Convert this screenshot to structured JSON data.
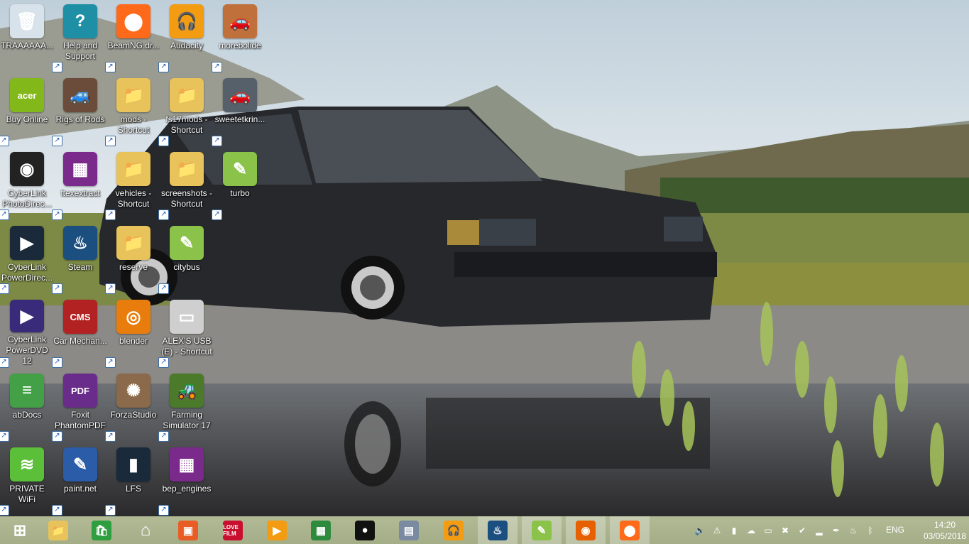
{
  "desktop": {
    "icons": [
      {
        "name": "recycle-bin",
        "label": "TRAAAAAA...",
        "glyph": "🗑",
        "color": "#d8e2ea"
      },
      {
        "name": "help-and-support",
        "label": "Help and Support",
        "glyph": "?",
        "color": "#1f8fa6"
      },
      {
        "name": "beamng",
        "label": "BeamNG.dr...",
        "glyph": "⬤",
        "color": "#ff6a1a"
      },
      {
        "name": "audacity",
        "label": "Audacity",
        "glyph": "🎧",
        "color": "#f39c12"
      },
      {
        "name": "morebolide",
        "label": "morebolide",
        "glyph": "🚗",
        "color": "#c0703a"
      },
      {
        "name": "buy-online",
        "label": "Buy Online",
        "glyph": "acer",
        "color": "#83b81a"
      },
      {
        "name": "rigs-of-rods",
        "label": "Rigs of Rods",
        "glyph": "🚙",
        "color": "#6b4c3b"
      },
      {
        "name": "mods-shortcut",
        "label": "mods - Shortcut",
        "glyph": "📁",
        "color": "#e8c25a"
      },
      {
        "name": "fs17mods-shortcut",
        "label": "fs17mods - Shortcut",
        "glyph": "📁",
        "color": "#e8c25a"
      },
      {
        "name": "sweetetkrin",
        "label": "sweetetkrin...",
        "glyph": "🚗",
        "color": "#55606a"
      },
      {
        "name": "cyberlink-photodirector",
        "label": "CyberLink PhotoDirec...",
        "glyph": "◉",
        "color": "#222"
      },
      {
        "name": "ftexextract",
        "label": "ftexextract",
        "glyph": "▦",
        "color": "#7a2a8a"
      },
      {
        "name": "vehicles-shortcut",
        "label": "vehicles - Shortcut",
        "glyph": "📁",
        "color": "#e8c25a"
      },
      {
        "name": "screenshots-shortcut",
        "label": "screenshots - Shortcut",
        "glyph": "📁",
        "color": "#e8c25a"
      },
      {
        "name": "turbo",
        "label": "turbo",
        "glyph": "✎",
        "color": "#8bc34a"
      },
      {
        "name": "cyberlink-powerdirector",
        "label": "CyberLink PowerDirec...",
        "glyph": "▶",
        "color": "#1a2a3a"
      },
      {
        "name": "steam",
        "label": "Steam",
        "glyph": "♨",
        "color": "#1b4f80"
      },
      {
        "name": "reserve",
        "label": "reserve",
        "glyph": "📁",
        "color": "#e8c25a"
      },
      {
        "name": "citybus",
        "label": "citybus",
        "glyph": "✎",
        "color": "#8bc34a"
      },
      {
        "name": "cyberlink-powerdvd",
        "label": "CyberLink PowerDVD 12",
        "glyph": "▶",
        "color": "#3a2a7a"
      },
      {
        "name": "car-mechanic",
        "label": "Car Mechan...",
        "glyph": "CMS",
        "color": "#b22222"
      },
      {
        "name": "blender",
        "label": "blender",
        "glyph": "◎",
        "color": "#e87d0d"
      },
      {
        "name": "alexs-usb-shortcut",
        "label": "ALEX'S USB (E) - Shortcut",
        "glyph": "▭",
        "color": "#cfcfcf"
      },
      {
        "name": "abdocs",
        "label": "abDocs",
        "glyph": "≡",
        "color": "#43a047"
      },
      {
        "name": "foxit-phantompdf",
        "label": "Foxit PhantomPDF",
        "glyph": "PDF",
        "color": "#6a2c8a"
      },
      {
        "name": "forzastudio",
        "label": "ForzaStudio",
        "glyph": "✺",
        "color": "#8a6a4a"
      },
      {
        "name": "farming-simulator-17",
        "label": "Farming Simulator 17",
        "glyph": "🚜",
        "color": "#4a7a2a"
      },
      {
        "name": "private-wifi",
        "label": "PRIVATE WiFi",
        "glyph": "≋",
        "color": "#5cbf3a"
      },
      {
        "name": "paint-net",
        "label": "paint.net",
        "glyph": "✎",
        "color": "#2a5ca8"
      },
      {
        "name": "lfs",
        "label": "LFS",
        "glyph": "▮",
        "color": "#1a2a3a"
      },
      {
        "name": "bep-engines",
        "label": "bep_engines",
        "glyph": "▦",
        "color": "#7a2a8a"
      }
    ]
  },
  "taskbar": {
    "buttons": [
      {
        "name": "start",
        "glyph": "⊞",
        "color": "transparent"
      },
      {
        "name": "file-explorer",
        "glyph": "📁",
        "color": "#e8c25a"
      },
      {
        "name": "store",
        "glyph": "🛍",
        "color": "#2e9e3e"
      },
      {
        "name": "home",
        "glyph": "⌂",
        "color": "transparent"
      },
      {
        "name": "photos",
        "glyph": "▣",
        "color": "#e85d26"
      },
      {
        "name": "lovefilm",
        "glyph": "LOVE FILM",
        "color": "#c8102e"
      },
      {
        "name": "media-player",
        "glyph": "▶",
        "color": "#f39c12"
      },
      {
        "name": "video-editor",
        "glyph": "▦",
        "color": "#2e8b3e"
      },
      {
        "name": "recorder",
        "glyph": "●",
        "color": "#111"
      },
      {
        "name": "photo-viewer",
        "glyph": "▤",
        "color": "#7a8aa0"
      },
      {
        "name": "audacity-task",
        "glyph": "🎧",
        "color": "#f39c12"
      },
      {
        "name": "steam-task",
        "glyph": "♨",
        "color": "#1b4f80"
      },
      {
        "name": "notepad-plus",
        "glyph": "✎",
        "color": "#8bc34a"
      },
      {
        "name": "firefox",
        "glyph": "◉",
        "color": "#e66000"
      },
      {
        "name": "beamng-task",
        "glyph": "⬤",
        "color": "#ff6a1a"
      }
    ],
    "tray": {
      "language": "ENG",
      "time": "14:20",
      "date": "03/05/2018",
      "icons": [
        "volume",
        "warning-network",
        "charger",
        "cloud",
        "monitor",
        "security-x",
        "shield-check",
        "signal",
        "feather",
        "steam-tray",
        "bluetooth"
      ]
    }
  }
}
